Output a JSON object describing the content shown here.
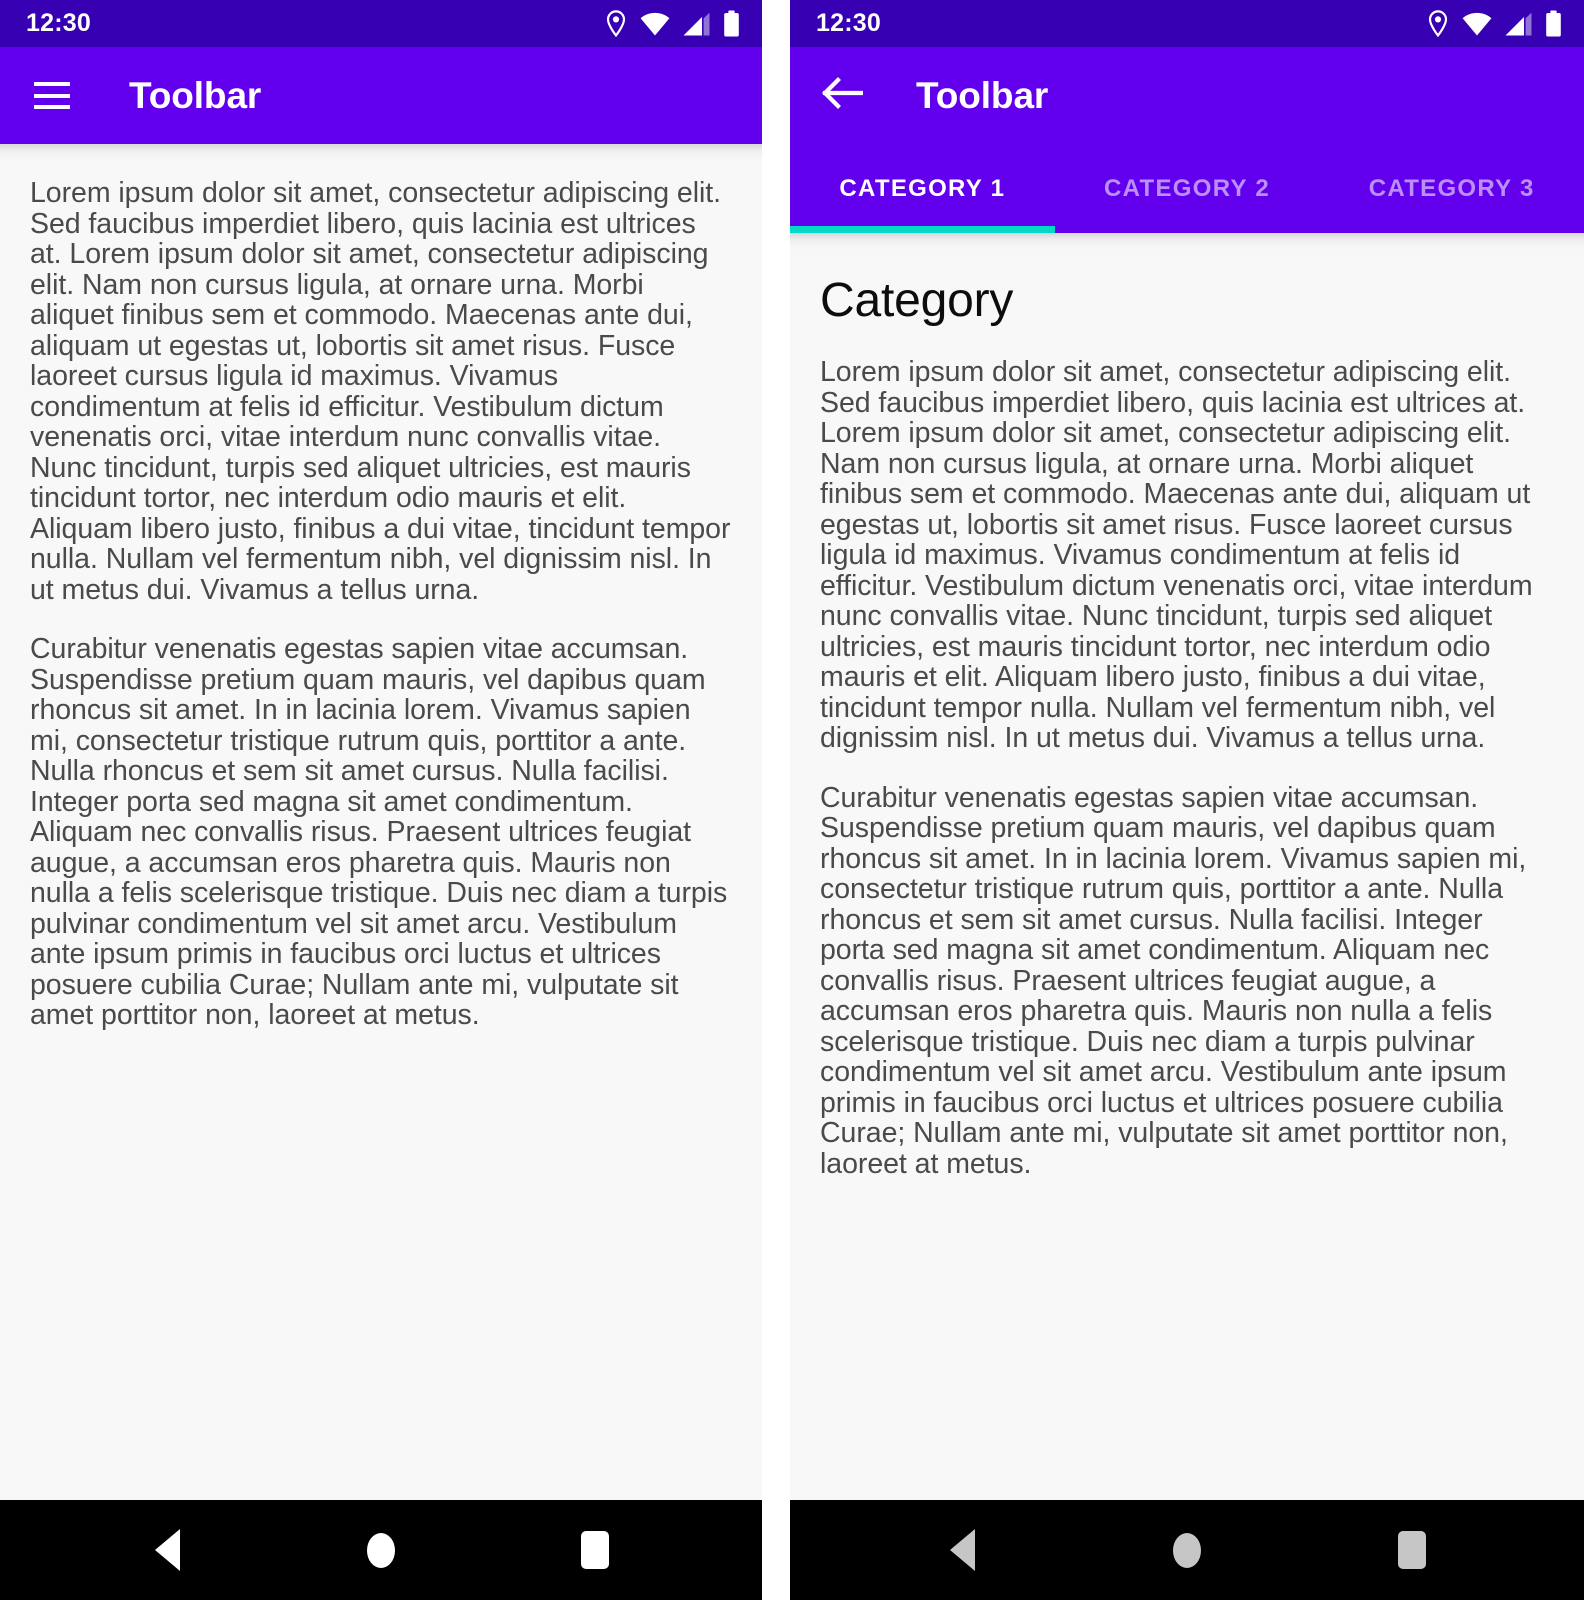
{
  "colors": {
    "status_bar": "#3700B3",
    "toolbar": "#6200EE",
    "tab_indicator": "#03DAC5",
    "content_background": "#F8F8F9",
    "body_text": "#4A4A4A",
    "nav_bar": "#000000"
  },
  "status_bar": {
    "time": "12:30",
    "icons": [
      "location-pin-icon",
      "wifi-icon",
      "cellular-signal-icon",
      "battery-icon"
    ]
  },
  "left_screen": {
    "toolbar": {
      "nav_icon": "hamburger-menu-icon",
      "title": "Toolbar"
    },
    "content": {
      "paragraphs": [
        "Lorem ipsum dolor sit amet, consectetur adipiscing elit. Sed faucibus imperdiet libero, quis lacinia est ultrices at. Lorem ipsum dolor sit amet, consectetur adipiscing elit. Nam non cursus ligula, at ornare urna. Morbi aliquet finibus sem et commodo. Maecenas ante dui, aliquam ut egestas ut, lobortis sit amet risus. Fusce laoreet cursus ligula id maximus. Vivamus condimentum at felis id efficitur. Vestibulum dictum venenatis orci, vitae interdum nunc convallis vitae. Nunc tincidunt, turpis sed aliquet ultricies, est mauris tincidunt tortor, nec interdum odio mauris et elit. Aliquam libero justo, finibus a dui vitae, tincidunt tempor nulla. Nullam vel fermentum nibh, vel dignissim nisl. In ut metus dui. Vivamus a tellus urna.",
        "Curabitur venenatis egestas sapien vitae accumsan. Suspendisse pretium quam mauris, vel dapibus quam rhoncus sit amet. In in lacinia lorem. Vivamus sapien mi, consectetur tristique rutrum quis, porttitor a ante. Nulla rhoncus et sem sit amet cursus. Nulla facilisi. Integer porta sed magna sit amet condimentum. Aliquam nec convallis risus. Praesent ultrices feugiat augue, a accumsan eros pharetra quis. Mauris non nulla a felis scelerisque tristique. Duis nec diam a turpis pulvinar condimentum vel sit amet arcu. Vestibulum ante ipsum primis in faucibus orci luctus et ultrices posuere cubilia Curae; Nullam ante mi, vulputate sit amet porttitor non, laoreet at metus."
      ]
    }
  },
  "right_screen": {
    "toolbar": {
      "nav_icon": "back-arrow-icon",
      "title": "Toolbar"
    },
    "tabs": [
      {
        "label": "CATEGORY 1",
        "active": true
      },
      {
        "label": "CATEGORY 2",
        "active": false
      },
      {
        "label": "CATEGORY 3",
        "active": false
      }
    ],
    "content": {
      "heading": "Category",
      "paragraphs": [
        "Lorem ipsum dolor sit amet, consectetur adipiscing elit. Sed faucibus imperdiet libero, quis lacinia est ultrices at. Lorem ipsum dolor sit amet, consectetur adipiscing elit. Nam non cursus ligula, at ornare urna. Morbi aliquet finibus sem et commodo. Maecenas ante dui, aliquam ut egestas ut, lobortis sit amet risus. Fusce laoreet cursus ligula id maximus. Vivamus condimentum at felis id efficitur. Vestibulum dictum venenatis orci, vitae interdum nunc convallis vitae. Nunc tincidunt, turpis sed aliquet ultricies, est mauris tincidunt tortor, nec interdum odio mauris et elit. Aliquam libero justo, finibus a dui vitae, tincidunt tempor nulla. Nullam vel fermentum nibh, vel dignissim nisl. In ut metus dui. Vivamus a tellus urna.",
        "Curabitur venenatis egestas sapien vitae accumsan. Suspendisse pretium quam mauris, vel dapibus quam rhoncus sit amet. In in lacinia lorem. Vivamus sapien mi, consectetur tristique rutrum quis, porttitor a ante. Nulla rhoncus et sem sit amet cursus. Nulla facilisi. Integer porta sed magna sit amet condimentum. Aliquam nec convallis risus. Praesent ultrices feugiat augue, a accumsan eros pharetra quis. Mauris non nulla a felis scelerisque tristique. Duis nec diam a turpis pulvinar condimentum vel sit amet arcu. Vestibulum ante ipsum primis in faucibus orci luctus et ultrices posuere cubilia Curae; Nullam ante mi, vulputate sit amet porttitor non, laoreet at metus."
      ]
    }
  },
  "nav_bar": {
    "buttons": [
      "back-triangle-icon",
      "home-circle-icon",
      "recents-square-icon"
    ]
  }
}
